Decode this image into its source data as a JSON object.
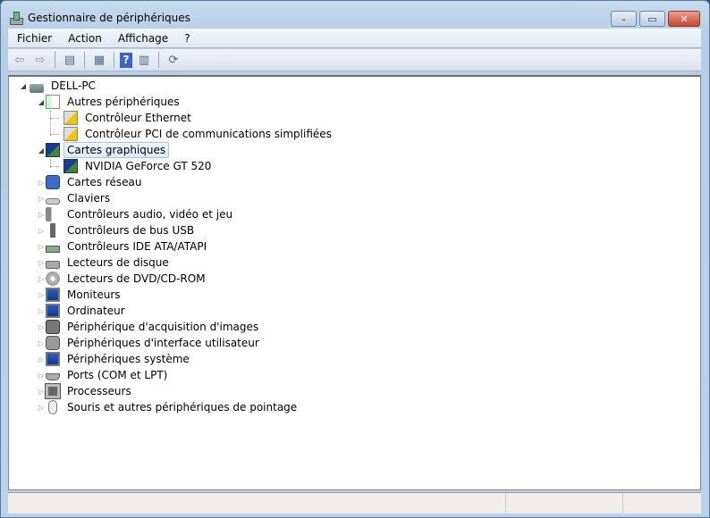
{
  "window": {
    "title": "Gestionnaire de périphériques",
    "minimize": "–",
    "maximize": "▭",
    "close": "✕"
  },
  "menu": [
    "Fichier",
    "Action",
    "Affichage",
    "?"
  ],
  "toolbar": [
    {
      "name": "back-button",
      "glyph": "⇦"
    },
    {
      "name": "forward-button",
      "glyph": "⇨"
    },
    {
      "sep": true
    },
    {
      "name": "show-hide-console-tree-button",
      "glyph": "▤"
    },
    {
      "sep": true
    },
    {
      "name": "properties-button",
      "glyph": "▦"
    },
    {
      "sep": true
    },
    {
      "name": "help-button",
      "glyph": "?"
    },
    {
      "name": "show-action-pane-button",
      "glyph": "▥"
    },
    {
      "sep": true
    },
    {
      "name": "scan-hardware-button",
      "glyph": "⟳"
    }
  ],
  "tree": [
    {
      "label": "DELL-PC",
      "level": 0,
      "state": "open",
      "icon": "computer"
    },
    {
      "label": "Autres périphériques",
      "level": 1,
      "state": "open",
      "icon": "unknown-device"
    },
    {
      "label": "Contrôleur Ethernet",
      "level": 2,
      "state": "none",
      "icon": "warning-device"
    },
    {
      "label": "Contrôleur PCI de communications simplifiées",
      "level": 2,
      "state": "none",
      "icon": "warning-device"
    },
    {
      "label": "Cartes graphiques",
      "level": 1,
      "state": "open",
      "icon": "display-adapter",
      "selected": true
    },
    {
      "label": "NVIDIA GeForce GT 520",
      "level": 2,
      "state": "none",
      "icon": "display-adapter"
    },
    {
      "label": "Cartes réseau",
      "level": 1,
      "state": "closed",
      "icon": "network"
    },
    {
      "label": "Claviers",
      "level": 1,
      "state": "closed",
      "icon": "keyboard"
    },
    {
      "label": "Contrôleurs audio, vidéo et jeu",
      "level": 1,
      "state": "closed",
      "icon": "speaker"
    },
    {
      "label": "Contrôleurs de bus USB",
      "level": 1,
      "state": "closed",
      "icon": "usb"
    },
    {
      "label": "Contrôleurs IDE ATA/ATAPI",
      "level": 1,
      "state": "closed",
      "icon": "ide"
    },
    {
      "label": "Lecteurs de disque",
      "level": 1,
      "state": "closed",
      "icon": "disk"
    },
    {
      "label": "Lecteurs de DVD/CD-ROM",
      "level": 1,
      "state": "closed",
      "icon": "dvd"
    },
    {
      "label": "Moniteurs",
      "level": 1,
      "state": "closed",
      "icon": "monitor"
    },
    {
      "label": "Ordinateur",
      "level": 1,
      "state": "closed",
      "icon": "monitor"
    },
    {
      "label": "Périphérique d'acquisition d'images",
      "level": 1,
      "state": "closed",
      "icon": "camera"
    },
    {
      "label": "Périphériques d'interface utilisateur",
      "level": 1,
      "state": "closed",
      "icon": "hid"
    },
    {
      "label": "Périphériques système",
      "level": 1,
      "state": "closed",
      "icon": "monitor"
    },
    {
      "label": "Ports (COM et LPT)",
      "level": 1,
      "state": "closed",
      "icon": "port"
    },
    {
      "label": "Processeurs",
      "level": 1,
      "state": "closed",
      "icon": "cpu"
    },
    {
      "label": "Souris et autres périphériques de pointage",
      "level": 1,
      "state": "closed",
      "icon": "mouse"
    }
  ],
  "colors": {
    "selection": "#dcebfc",
    "titlebar": "#c5d9ee",
    "close": "#c8452d"
  }
}
